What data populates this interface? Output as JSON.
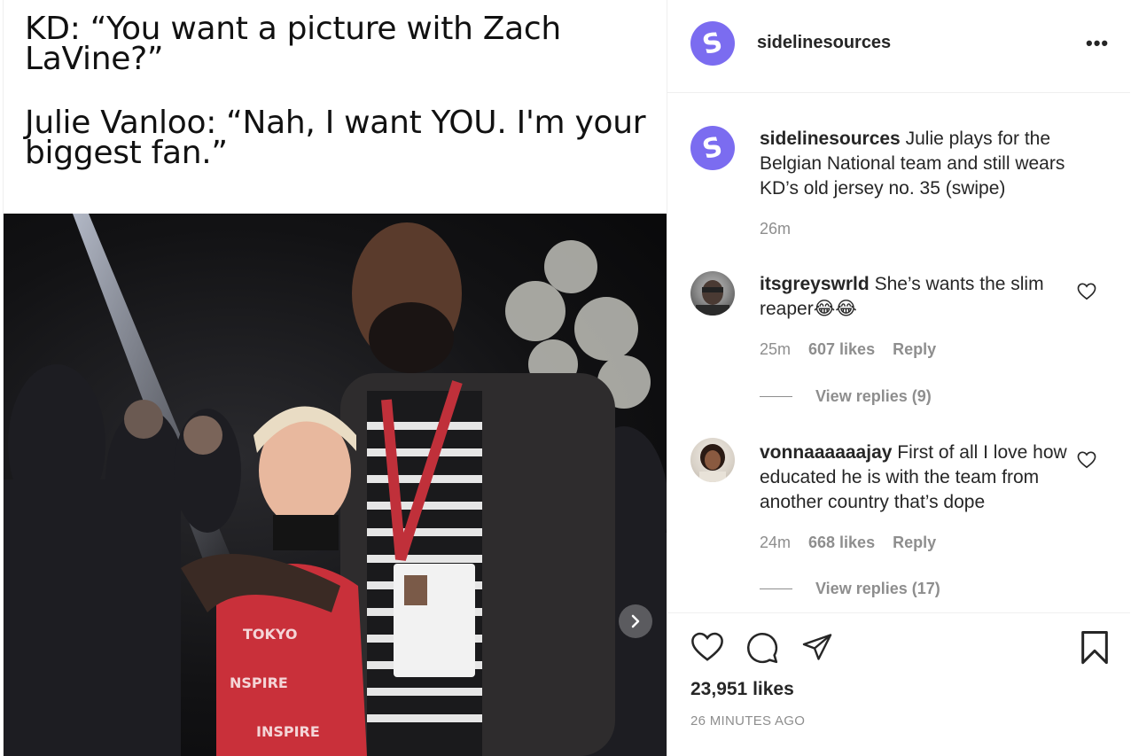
{
  "post": {
    "image_caption": {
      "line1": "KD: “You want a picture with Zach LaVine?”",
      "line2": "Julie Vanloo: “Nah, I want YOU. I'm your biggest fan.”"
    },
    "next_icon": "chevron-right-icon"
  },
  "header": {
    "avatar_letter": "S",
    "username": "sidelinesources",
    "more_icon": "more-horizontal-icon",
    "more_label": "•••"
  },
  "caption": {
    "username": "sidelinesources",
    "text": "Julie plays for the Belgian National team and still wears KD’s old jersey no. 35 (swipe)",
    "time": "26m"
  },
  "comments": [
    {
      "username": "itsgreyswrld",
      "text": "She’s wants the slim reaper😂😂",
      "time": "25m",
      "likes": "607 likes",
      "reply": "Reply",
      "view_replies": "View replies (9)"
    },
    {
      "username": "vonnaaaaaajay",
      "text": "First of all I love how educated he is with the team from another country that’s dope",
      "time": "24m",
      "likes": "668 likes",
      "reply": "Reply",
      "view_replies": "View replies (17)"
    }
  ],
  "actions": {
    "like_icon": "heart-icon",
    "comment_icon": "comment-icon",
    "share_icon": "share-icon",
    "save_icon": "bookmark-icon",
    "likes_count": "23,951 likes",
    "posted_ago": "26 MINUTES AGO"
  },
  "colors": {
    "avatar": "#7b6cf0",
    "muted": "#8e8e8e",
    "text": "#262626"
  }
}
